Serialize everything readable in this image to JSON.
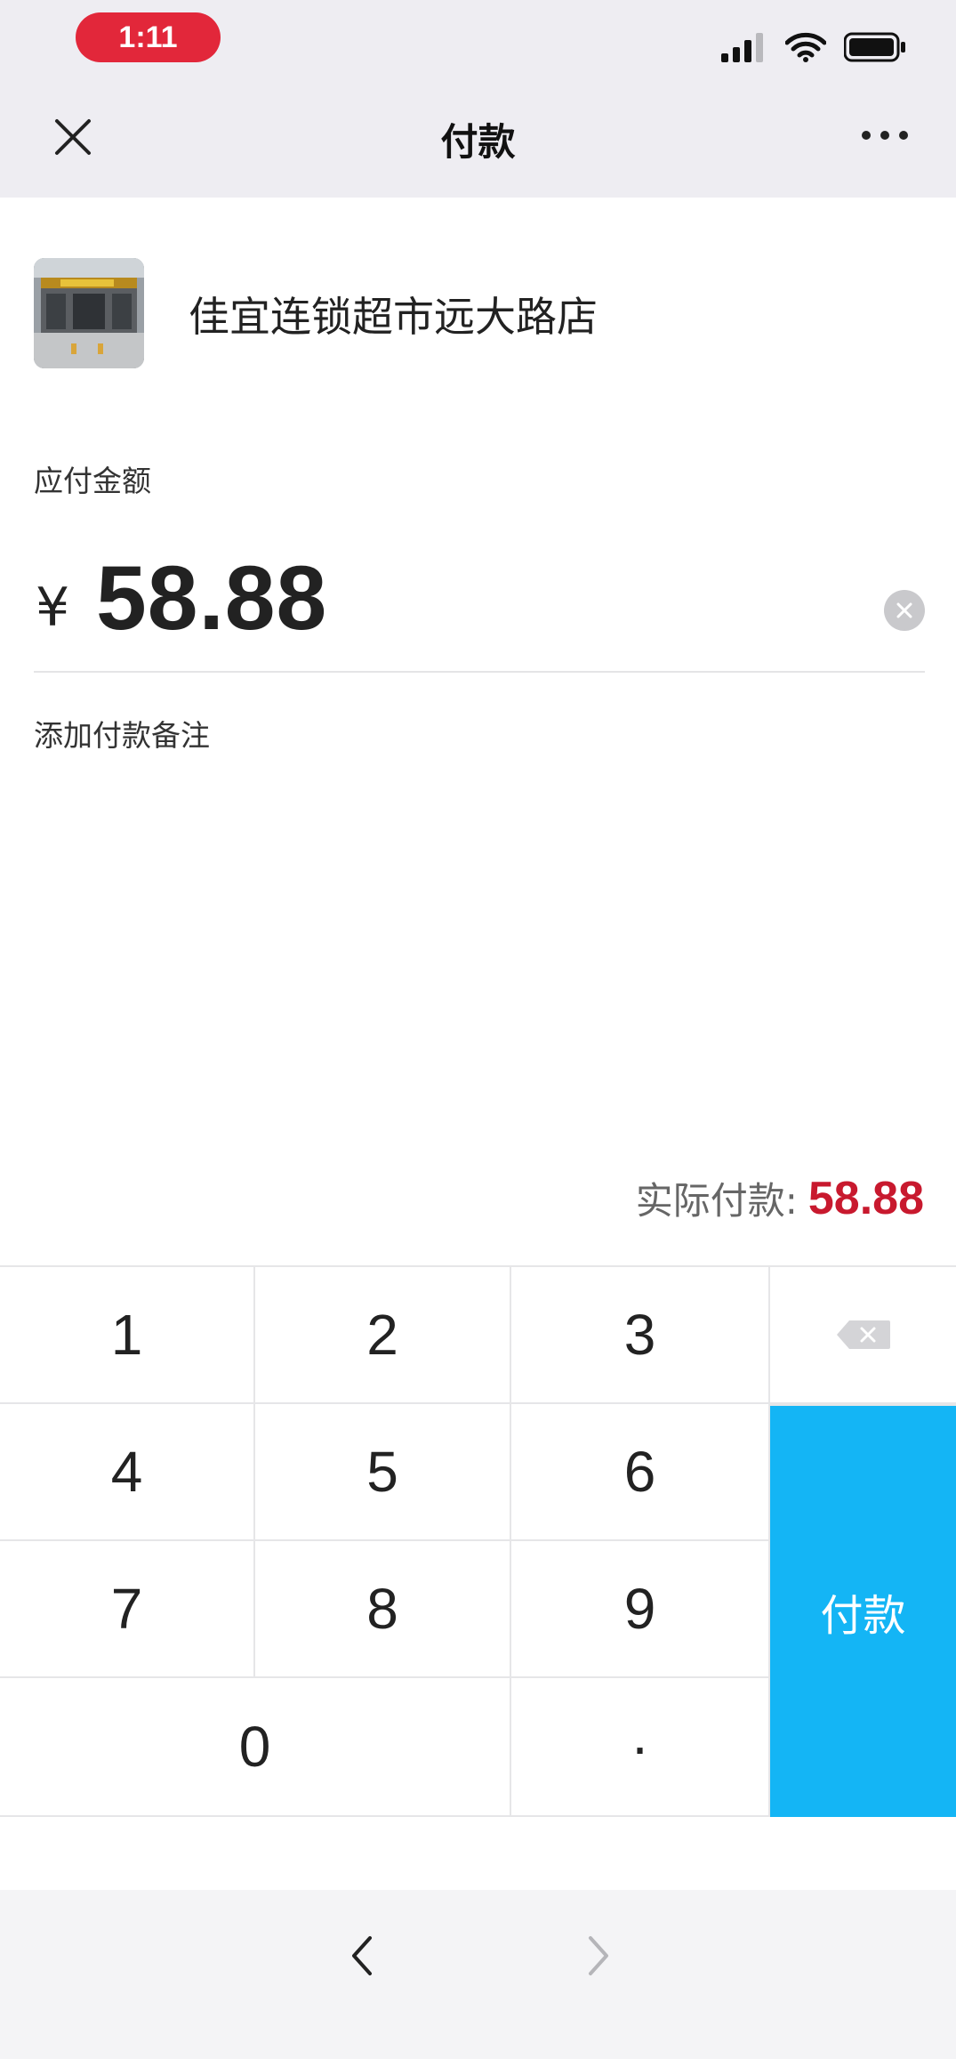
{
  "status_bar": {
    "time": "1:11"
  },
  "nav": {
    "title": "付款"
  },
  "merchant": {
    "name": "佳宜连锁超市远大路店"
  },
  "payment": {
    "amount_label": "应付金额",
    "currency_symbol": "¥",
    "amount": "58.88",
    "remark_label": "添加付款备注",
    "actual_label": "实际付款:",
    "actual_amount": "58.88"
  },
  "keypad": {
    "keys": [
      "1",
      "2",
      "3",
      "4",
      "5",
      "6",
      "7",
      "8",
      "9",
      "0",
      "·"
    ],
    "pay_label": "付款"
  },
  "colors": {
    "accent": "#14b5f5",
    "amount_red": "#c8192e",
    "time_pill": "#e2273a"
  }
}
